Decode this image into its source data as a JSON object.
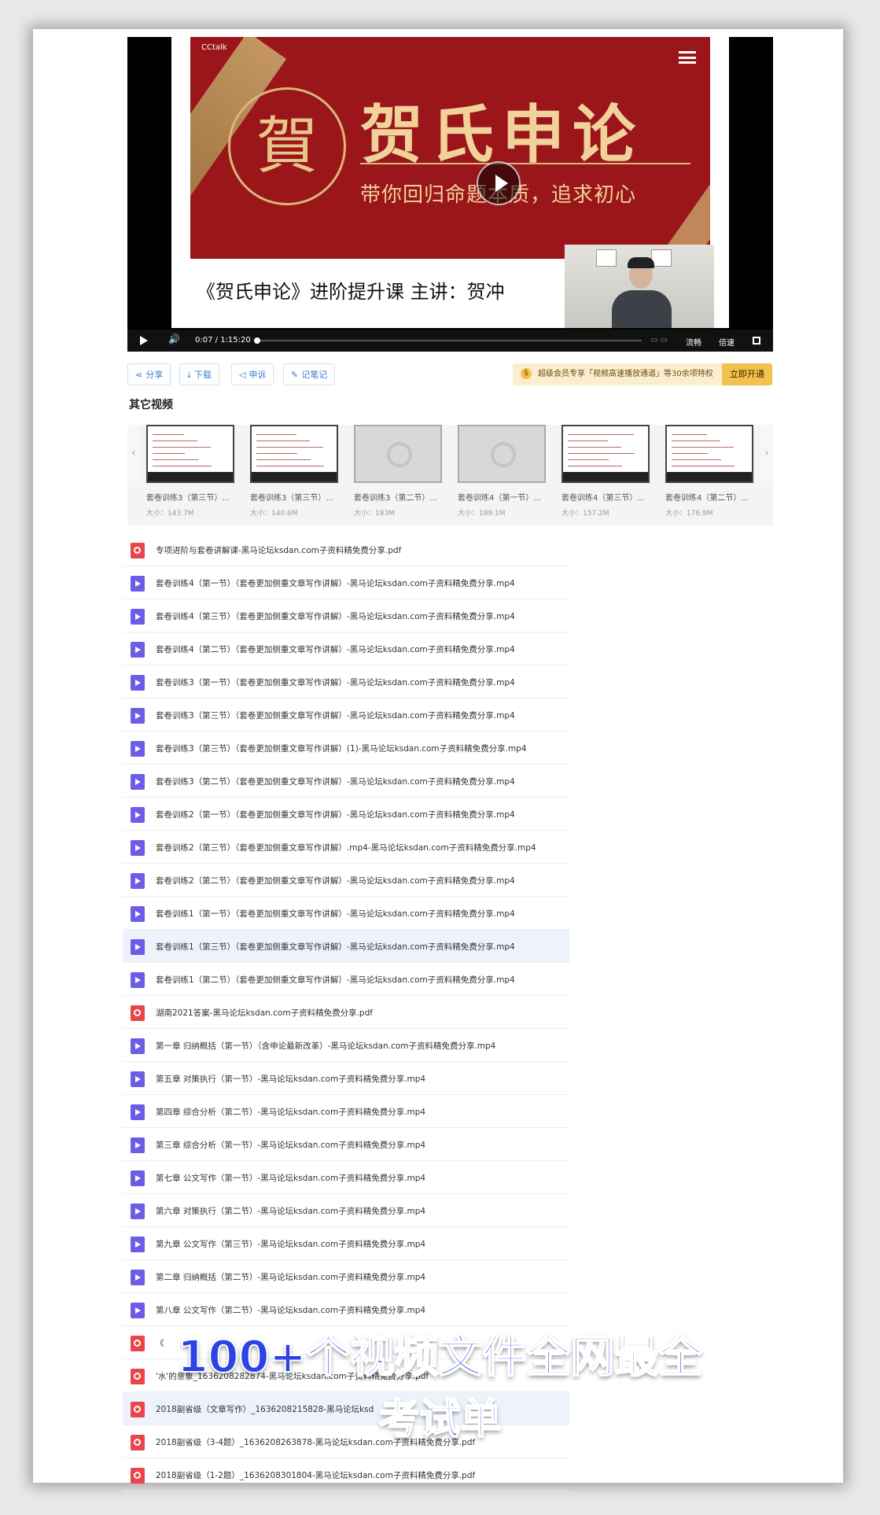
{
  "player": {
    "watermark": "CCtalk",
    "banner_title": "贺氏申论",
    "banner_subtitle": "带你回归命题本质，追求初心",
    "seal_char": "賀",
    "course_line": "《贺氏申论》进阶提升课  主讲：贺冲",
    "time_current": "0:07",
    "time_sep": " / ",
    "time_total": "1:15:20",
    "quality_label": "流畅",
    "speed_label": "倍速",
    "progress_fraction": 0.0015
  },
  "actions": {
    "share": "分享",
    "download": "下载",
    "report": "申诉",
    "notes": "记笔记",
    "vip_badge": "$",
    "vip_text": "超级会员专享「视频高速播放通道」等30余项特权",
    "vip_button": "立即开通"
  },
  "section_title": "其它视频",
  "related": [
    {
      "title": "套卷训练3（第三节）...",
      "size": "大小：143.7M",
      "thumb": "doc"
    },
    {
      "title": "套卷训练3（第三节）...",
      "size": "大小：140.6M",
      "thumb": "doc"
    },
    {
      "title": "套卷训练3（第二节）...",
      "size": "大小：183M",
      "thumb": "empty"
    },
    {
      "title": "套卷训练4（第一节）...",
      "size": "大小：189.1M",
      "thumb": "empty"
    },
    {
      "title": "套卷训练4（第三节）...",
      "size": "大小：157.2M",
      "thumb": "doc"
    },
    {
      "title": "套卷训练4（第二节）...",
      "size": "大小：176.9M",
      "thumb": "doc"
    }
  ],
  "files": [
    {
      "type": "pdf",
      "name": "专项进阶与套卷讲解课-黑马论坛ksdan.com子资料精免费分享.pdf"
    },
    {
      "type": "mp4",
      "name": "套卷训练4（第一节）（套卷更加侧重文章写作讲解）-黑马论坛ksdan.com子资料精免费分享.mp4"
    },
    {
      "type": "mp4",
      "name": "套卷训练4（第三节）（套卷更加侧重文章写作讲解）-黑马论坛ksdan.com子资料精免费分享.mp4"
    },
    {
      "type": "mp4",
      "name": "套卷训练4（第二节）（套卷更加侧重文章写作讲解）-黑马论坛ksdan.com子资料精免费分享.mp4"
    },
    {
      "type": "mp4",
      "name": "套卷训练3（第一节）（套卷更加侧重文章写作讲解）-黑马论坛ksdan.com子资料精免费分享.mp4"
    },
    {
      "type": "mp4",
      "name": "套卷训练3（第三节）（套卷更加侧重文章写作讲解）-黑马论坛ksdan.com子资料精免费分享.mp4"
    },
    {
      "type": "mp4",
      "name": "套卷训练3（第三节）（套卷更加侧重文章写作讲解）(1)-黑马论坛ksdan.com子资料精免费分享.mp4"
    },
    {
      "type": "mp4",
      "name": "套卷训练3（第二节）（套卷更加侧重文章写作讲解）-黑马论坛ksdan.com子资料精免费分享.mp4"
    },
    {
      "type": "mp4",
      "name": "套卷训练2（第一节）（套卷更加侧重文章写作讲解）-黑马论坛ksdan.com子资料精免费分享.mp4"
    },
    {
      "type": "mp4",
      "name": "套卷训练2（第三节）（套卷更加侧重文章写作讲解）.mp4-黑马论坛ksdan.com子资料精免费分享.mp4"
    },
    {
      "type": "mp4",
      "name": "套卷训练2（第二节）（套卷更加侧重文章写作讲解）-黑马论坛ksdan.com子资料精免费分享.mp4"
    },
    {
      "type": "mp4",
      "name": "套卷训练1（第一节）（套卷更加侧重文章写作讲解）-黑马论坛ksdan.com子资料精免费分享.mp4"
    },
    {
      "type": "mp4",
      "name": "套卷训练1（第三节）（套卷更加侧重文章写作讲解）-黑马论坛ksdan.com子资料精免费分享.mp4",
      "highlight": true
    },
    {
      "type": "mp4",
      "name": "套卷训练1（第二节）（套卷更加侧重文章写作讲解）-黑马论坛ksdan.com子资料精免费分享.mp4"
    },
    {
      "type": "pdf",
      "name": "湖南2021答案-黑马论坛ksdan.com子资料精免费分享.pdf"
    },
    {
      "type": "mp4",
      "name": "第一章 归纳概括（第一节）（含申论最新改革）-黑马论坛ksdan.com子资料精免费分享.mp4"
    },
    {
      "type": "mp4",
      "name": "第五章 对策执行（第一节）-黑马论坛ksdan.com子资料精免费分享.mp4"
    },
    {
      "type": "mp4",
      "name": "第四章 综合分析（第二节）-黑马论坛ksdan.com子资料精免费分享.mp4"
    },
    {
      "type": "mp4",
      "name": "第三章 综合分析（第一节）-黑马论坛ksdan.com子资料精免费分享.mp4"
    },
    {
      "type": "mp4",
      "name": "第七章 公文写作（第一节）-黑马论坛ksdan.com子资料精免费分享.mp4"
    },
    {
      "type": "mp4",
      "name": "第六章 对策执行（第二节）-黑马论坛ksdan.com子资料精免费分享.mp4"
    },
    {
      "type": "mp4",
      "name": "第九章 公文写作（第三节）-黑马论坛ksdan.com子资料精免费分享.mp4"
    },
    {
      "type": "mp4",
      "name": "第二章 归纳概括（第二节）-黑马论坛ksdan.com子资料精免费分享.mp4"
    },
    {
      "type": "mp4",
      "name": "第八章 公文写作（第二节）-黑马论坛ksdan.com子资料精免费分享.mp4"
    },
    {
      "type": "pdf",
      "name": "《"
    },
    {
      "type": "pdf",
      "name": "'水'的意象_1636208282874-黑马论坛ksdan.com子资料精免费分享.pdf"
    },
    {
      "type": "pdf",
      "name": "2018副省级（文章写作）_1636208215828-黑马论坛ksd",
      "highlight": true
    },
    {
      "type": "pdf",
      "name": "2018副省级（3-4题）_1636208263878-黑马论坛ksdan.com子资料精免费分享.pdf"
    },
    {
      "type": "pdf",
      "name": "2018副省级（1-2题）_1636208301804-黑马论坛ksdan.com子资料精免费分享.pdf"
    }
  ],
  "overlay": {
    "line1": "100+个视频文件全网最全",
    "line2": "考试单"
  }
}
